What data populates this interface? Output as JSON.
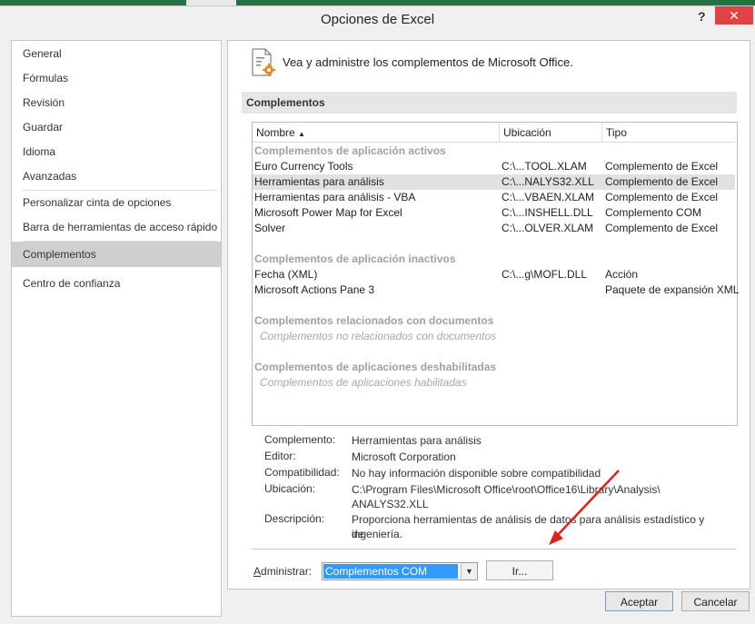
{
  "dialog": {
    "title": "Opciones de Excel",
    "help_label": "?",
    "close_label": "✕"
  },
  "sidebar": {
    "items": [
      {
        "label": "General"
      },
      {
        "label": "Fórmulas"
      },
      {
        "label": "Revisión"
      },
      {
        "label": "Guardar"
      },
      {
        "label": "Idioma"
      },
      {
        "label": "Avanzadas"
      },
      {
        "label": "Personalizar cinta de opciones"
      },
      {
        "label": "Barra de herramientas de acceso rápido"
      },
      {
        "label": "Complementos"
      },
      {
        "label": "Centro de confianza"
      }
    ],
    "selected": "Complementos"
  },
  "main": {
    "header_text": "Vea y administre los complementos de Microsoft Office.",
    "section_title": "Complementos",
    "columns": {
      "name": "Nombre",
      "location": "Ubicación",
      "type": "Tipo"
    },
    "sort_icon": "sort-ascending-icon",
    "groups": [
      {
        "title": "Complementos de aplicación activos",
        "rows": [
          {
            "name": "Euro Currency Tools",
            "location": "C:\\...TOOL.XLAM",
            "type": "Complemento de Excel"
          },
          {
            "name": "Herramientas para análisis",
            "location": "C:\\...NALYS32.XLL",
            "type": "Complemento de Excel"
          },
          {
            "name": "Herramientas para análisis - VBA",
            "location": "C:\\...VBAEN.XLAM",
            "type": "Complemento de Excel"
          },
          {
            "name": "Microsoft Power Map for Excel",
            "location": "C:\\...INSHELL.DLL",
            "type": "Complemento COM"
          },
          {
            "name": "Solver",
            "location": "C:\\...OLVER.XLAM",
            "type": "Complemento de Excel"
          }
        ]
      },
      {
        "title": "Complementos de aplicación inactivos",
        "rows": [
          {
            "name": "Fecha (XML)",
            "location": "C:\\...g\\MOFL.DLL",
            "type": "Acción"
          },
          {
            "name": "Microsoft Actions Pane 3",
            "location": "",
            "type": "Paquete de expansión XML"
          }
        ]
      },
      {
        "title": "Complementos relacionados con documentos",
        "empty": "Complementos no relacionados con documentos"
      },
      {
        "title": "Complementos de aplicaciones deshabilitadas",
        "empty": "Complementos de aplicaciones habilitadas"
      }
    ],
    "details": {
      "addin_label": "Complemento:",
      "addin_value": "Herramientas para análisis",
      "publisher_label": "Editor:",
      "publisher_value": "Microsoft Corporation",
      "compat_label": "Compatibilidad:",
      "compat_value": "No hay información disponible sobre compatibilidad",
      "location_label": "Ubicación:",
      "location_value_1": "C:\\Program Files\\Microsoft Office\\root\\Office16\\Library\\Analysis\\",
      "location_value_2": "ANALYS32.XLL",
      "desc_label": "Descripción:",
      "desc_value_1": "Proporciona herramientas de análisis de datos para análisis estadístico y de",
      "desc_value_2": "ingeniería."
    },
    "manage": {
      "label_pre": "A",
      "label_rest": "dministrar:",
      "selected": "Complementos COM",
      "go_label": "Ir..."
    }
  },
  "footer": {
    "ok_label": "Aceptar",
    "cancel_label": "Cancelar"
  },
  "colors": {
    "ribbon": "#217346",
    "selection": "#3399ff",
    "close": "#e04343",
    "annotation_arrow": "#e02020"
  }
}
